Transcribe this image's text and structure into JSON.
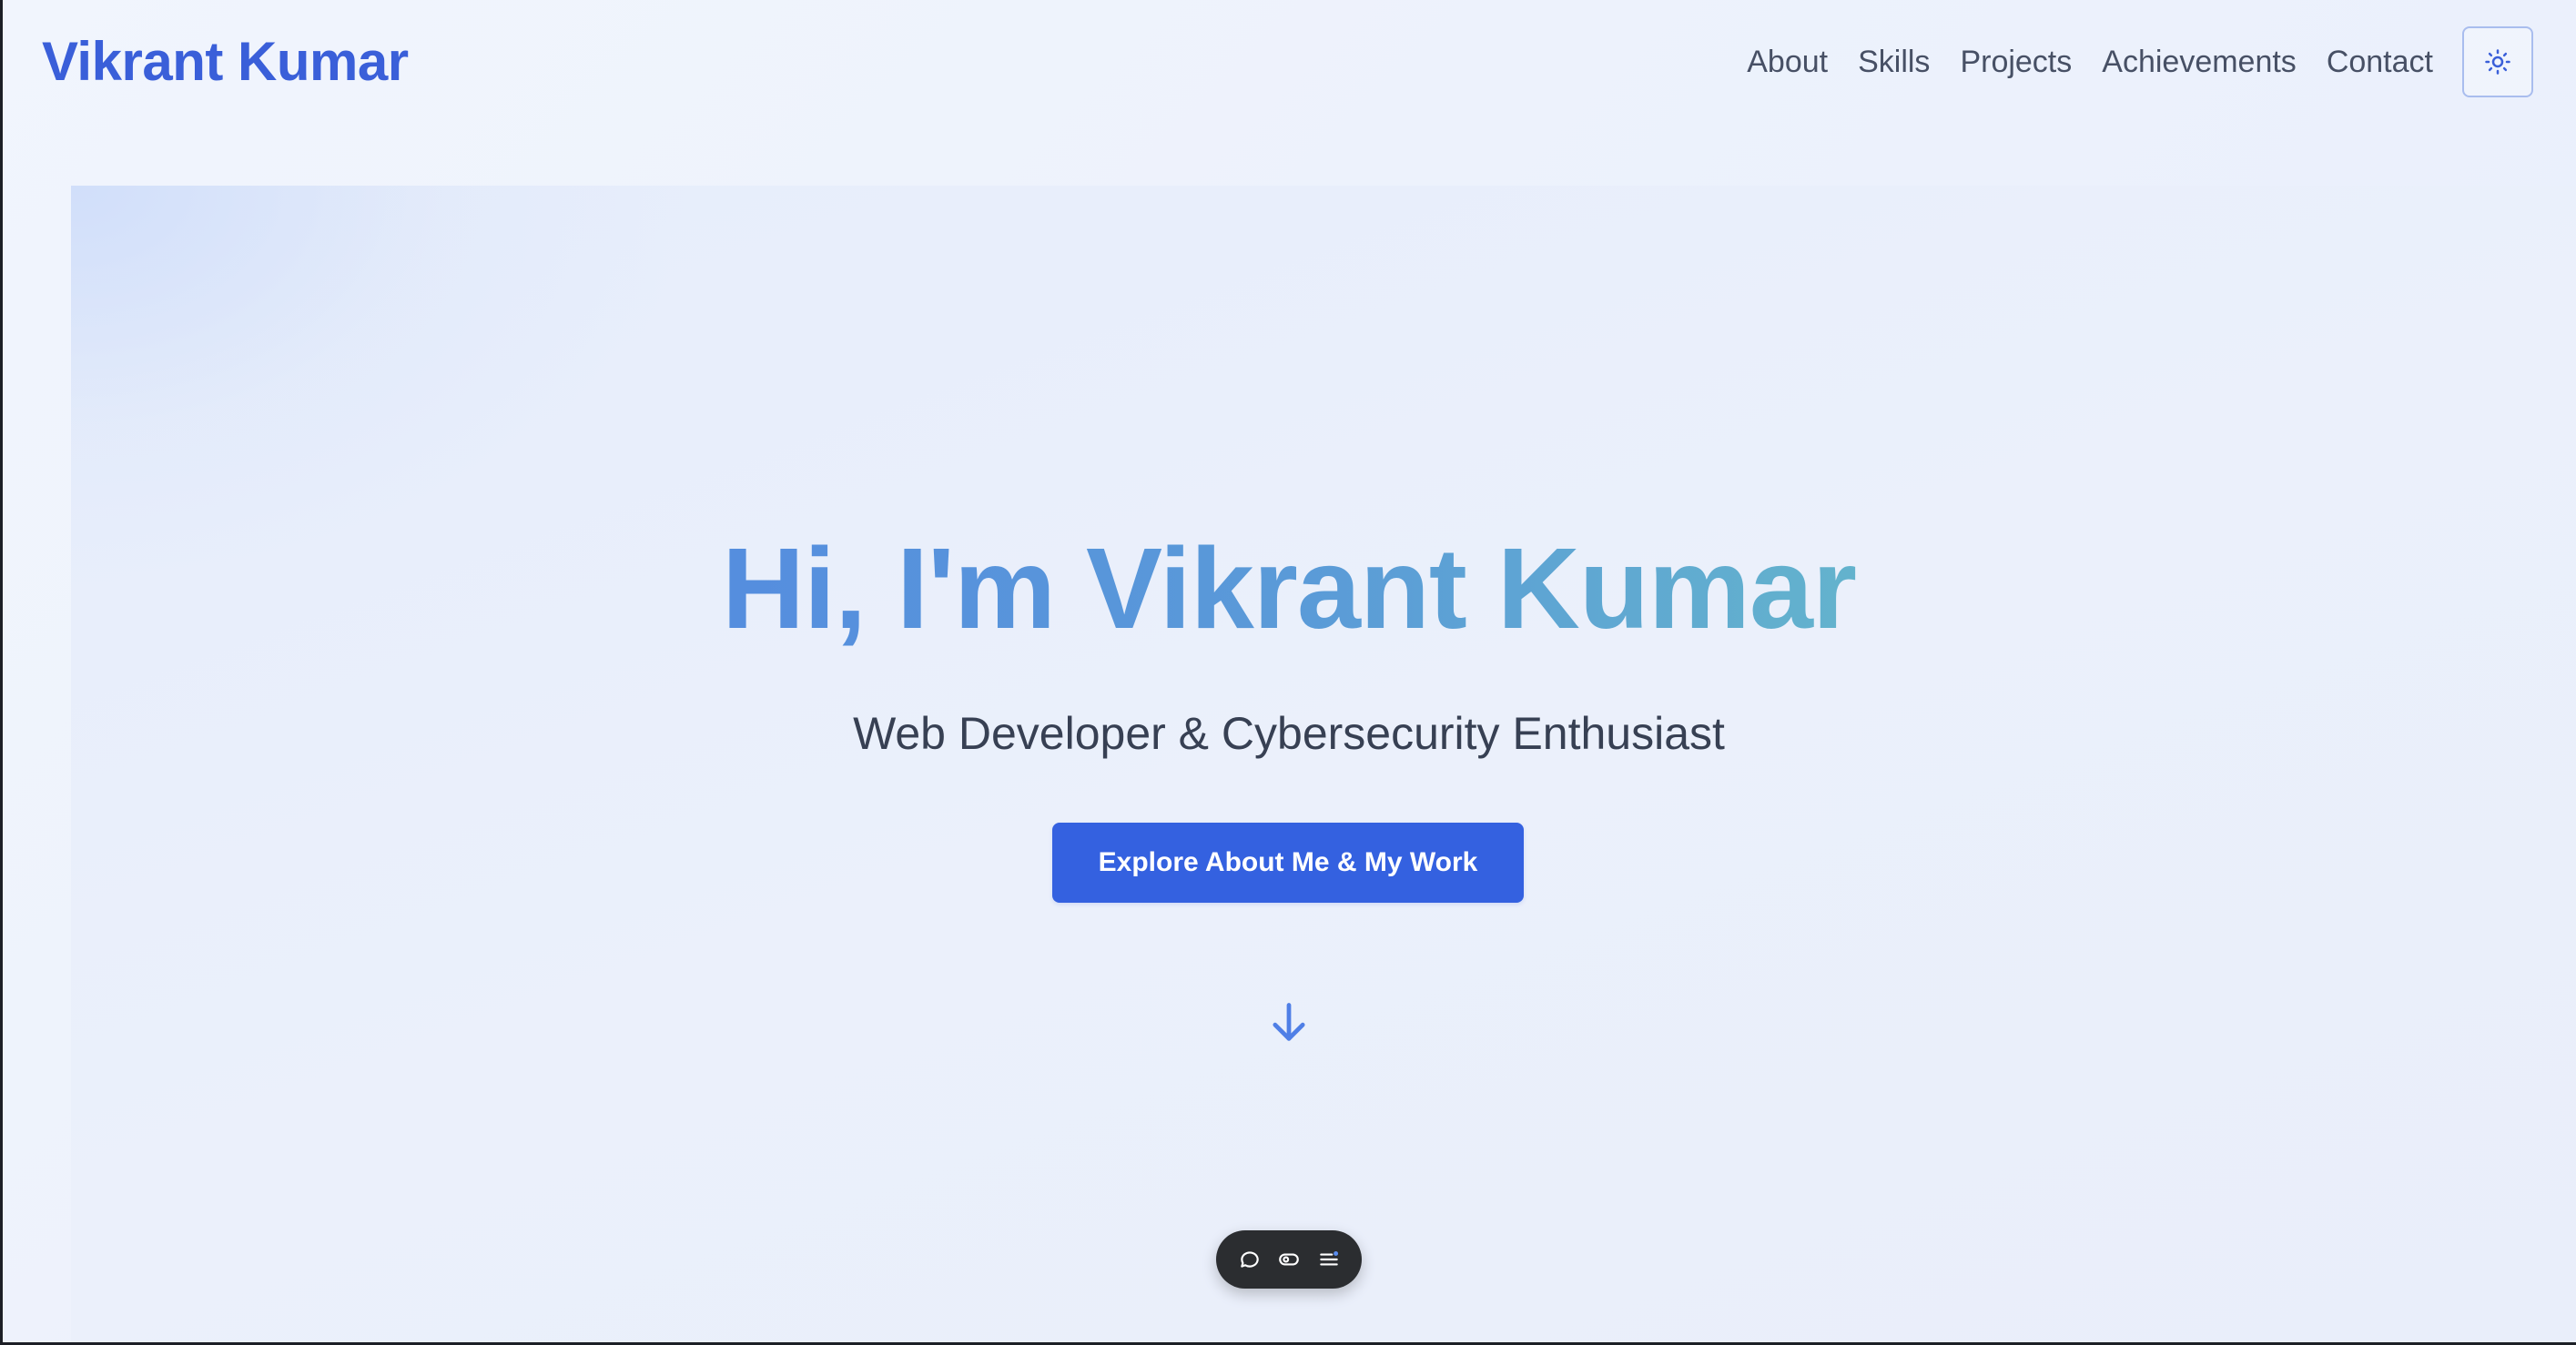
{
  "header": {
    "brand": "Vikrant Kumar",
    "nav": [
      {
        "label": "About"
      },
      {
        "label": "Skills"
      },
      {
        "label": "Projects"
      },
      {
        "label": "Achievements"
      },
      {
        "label": "Contact"
      }
    ],
    "theme_toggle_icon": "sun-icon"
  },
  "hero": {
    "title": "Hi, I'm Vikrant Kumar",
    "subtitle": "Web Developer & Cybersecurity Enthusiast",
    "cta_label": "Explore About Me & My Work",
    "scroll_icon": "arrow-down-icon"
  },
  "toolbar": {
    "icons": [
      "comment-icon",
      "toggle-icon",
      "menu-icon"
    ]
  },
  "colors": {
    "brand": "#3a5fd9",
    "cta": "#3461e0",
    "gradient_start": "#4f7fe6",
    "gradient_end": "#6ecfc0",
    "toolbar_bg": "#2b2d30"
  }
}
